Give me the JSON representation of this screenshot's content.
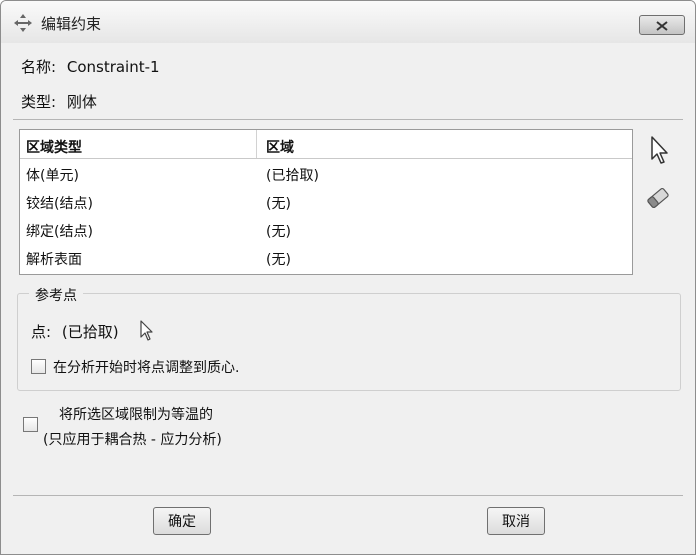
{
  "window": {
    "title": "编辑约束",
    "close_symbol": "—x—",
    "title_icon": "crosshair-move-icon"
  },
  "fields": {
    "name_label": "名称:",
    "name_value": "Constraint-1",
    "type_label": "类型:",
    "type_value": "刚体"
  },
  "table": {
    "headers": [
      "区域类型",
      "区域"
    ],
    "rows": [
      [
        "体(单元)",
        "(已拾取)"
      ],
      [
        "铰结(结点)",
        "(无)"
      ],
      [
        "绑定(结点)",
        "(无)"
      ],
      [
        "解析表面",
        "(无)"
      ]
    ]
  },
  "side_tools": [
    "select-arrow-icon",
    "eraser-icon"
  ],
  "reference_point": {
    "group_title": "参考点",
    "point_label": "点:",
    "point_value": "(已拾取)",
    "adjust_checkbox_label": "在分析开始时将点调整到质心.",
    "adjust_checked": false
  },
  "isothermal": {
    "label_line1": "将所选区域限制为等温的",
    "label_line2": "(只应用于耦合热 - 应力分析)",
    "checked": false
  },
  "buttons": {
    "ok": "确定",
    "cancel": "取消"
  }
}
